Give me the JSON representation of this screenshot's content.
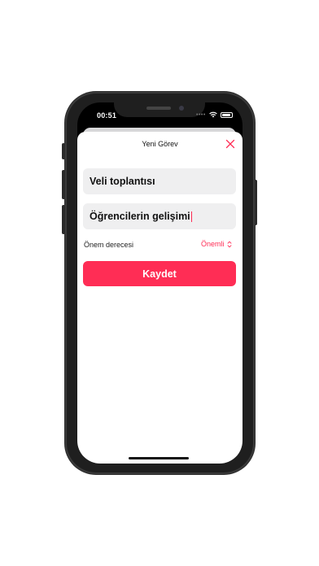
{
  "status_bar": {
    "time": "00:51"
  },
  "sheet": {
    "title": "Yeni Görev",
    "task_title_value": "Veli toplantısı",
    "task_note_value": "Öğrencilerin gelişimi",
    "priority_label": "Önem derecesi",
    "priority_value": "Önemli",
    "save_label": "Kaydet"
  },
  "icons": {
    "close": "close-icon",
    "priority_chevron": "chevron-up-down-icon",
    "wifi": "wifi-icon",
    "battery": "battery-icon"
  },
  "colors": {
    "accent": "#ff2d55",
    "field_background": "#efeff0"
  }
}
